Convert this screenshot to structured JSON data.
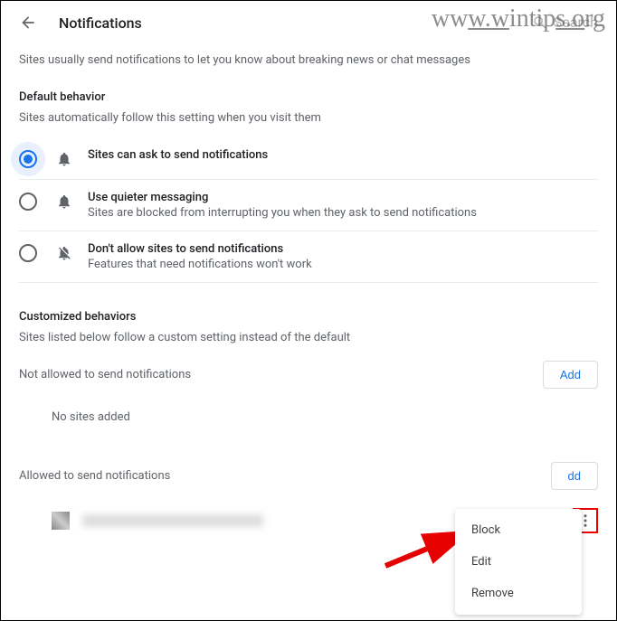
{
  "header": {
    "title": "Notifications",
    "search_placeholder": "Search"
  },
  "intro": "Sites usually send notifications to let you know about breaking news or chat messages",
  "default_behavior": {
    "title": "Default behavior",
    "subtitle": "Sites automatically follow this setting when you visit them",
    "options": [
      {
        "title": "Sites can ask to send notifications",
        "sub": ""
      },
      {
        "title": "Use quieter messaging",
        "sub": "Sites are blocked from interrupting you when they ask to send notifications"
      },
      {
        "title": "Don't allow sites to send notifications",
        "sub": "Features that need notifications won't work"
      }
    ]
  },
  "custom": {
    "title": "Customized behaviors",
    "subtitle": "Sites listed below follow a custom setting instead of the default"
  },
  "blocked": {
    "title": "Not allowed to send notifications",
    "add": "Add",
    "empty": "No sites added"
  },
  "allowed": {
    "title": "Allowed to send notifications",
    "add": "dd"
  },
  "menu": {
    "block": "Block",
    "edit": "Edit",
    "remove": "Remove"
  },
  "watermark": "www.wintips.org"
}
